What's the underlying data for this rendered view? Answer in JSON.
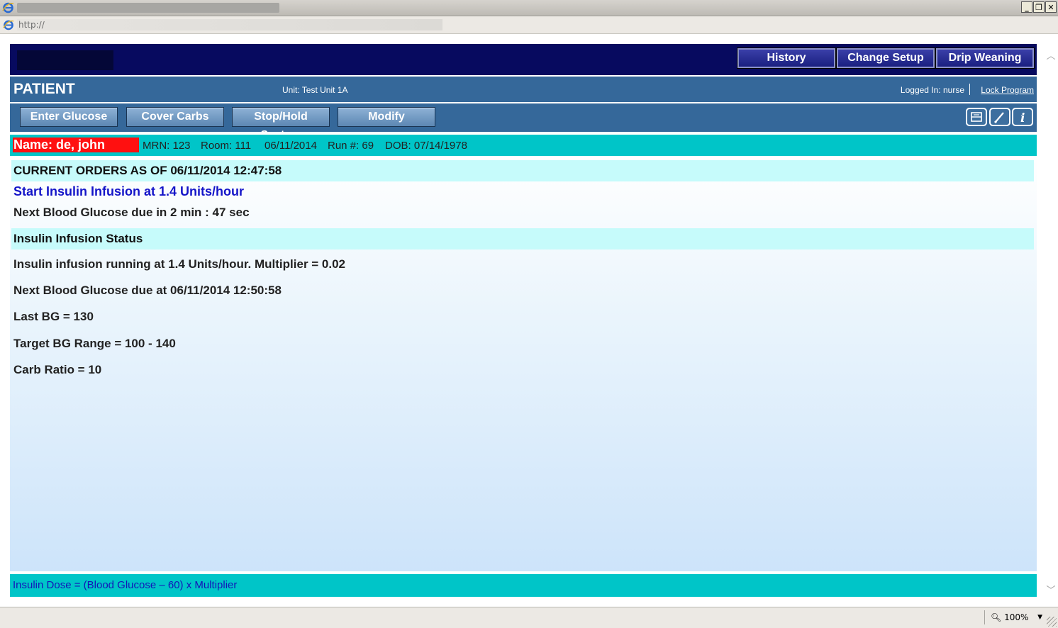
{
  "browser": {
    "address": "http://",
    "zoom": "100%",
    "window_buttons": [
      "_",
      "❐",
      "✕"
    ]
  },
  "topnav": [
    {
      "label": "History"
    },
    {
      "label": "Change Setup"
    },
    {
      "label": "Drip Weaning"
    }
  ],
  "header": {
    "title": "PATIENT",
    "unit": "Unit: Test Unit 1A",
    "logged_in": "Logged In: nurse",
    "lock_link": "Lock Program"
  },
  "actions": [
    {
      "label": "Enter Glucose"
    },
    {
      "label": "Cover Carbs"
    },
    {
      "label": "Stop/Hold System"
    },
    {
      "label": "Modify"
    }
  ],
  "tool_icons": [
    "print-icon",
    "edit-icon",
    "info-icon"
  ],
  "patient": {
    "name": "Name: de, john",
    "mrn": "MRN: 123",
    "room": "Room: 111",
    "date": "06/11/2014",
    "run": "Run #: 69",
    "dob": "DOB: 07/14/1978"
  },
  "orders": {
    "header": "CURRENT ORDERS AS OF 06/11/2014 12:47:58",
    "instruction": "Start Insulin Infusion at 1.4 Units/hour",
    "next_due": "Next Blood Glucose due in 2 min : 47 sec"
  },
  "status": {
    "header": "Insulin Infusion Status",
    "lines": [
      "Insulin infusion running at 1.4 Units/hour. Multiplier = 0.02",
      "Next Blood Glucose due at 06/11/2014 12:50:58",
      "Last BG = 130",
      "Target BG Range = 100 - 140",
      "Carb Ratio = 10"
    ]
  },
  "footer": {
    "formula": "Insulin Dose = (Blood Glucose – 60) x Multiplier"
  },
  "colors": {
    "topbar": "#070a5f",
    "header_blue": "#35689a",
    "teal": "#00c5c8",
    "name_red": "#ff1010",
    "order_blue": "#1414c8"
  }
}
